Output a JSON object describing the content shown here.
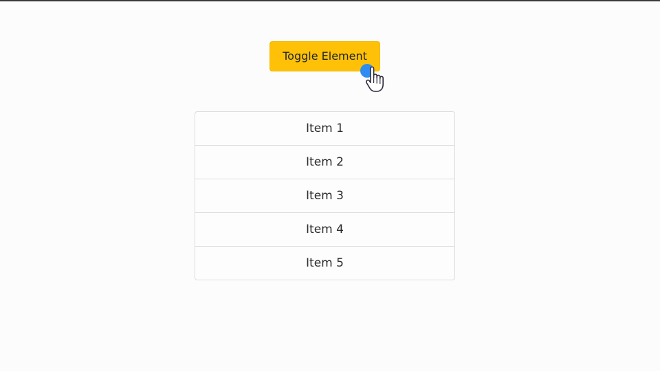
{
  "toggle_button": {
    "label": "Toggle Element",
    "color": "#ffc107"
  },
  "list": {
    "items": [
      {
        "label": "Item 1"
      },
      {
        "label": "Item 2"
      },
      {
        "label": "Item 3"
      },
      {
        "label": "Item 4"
      },
      {
        "label": "Item 5"
      }
    ]
  },
  "cursor": {
    "icon": "hand-pointer-icon",
    "click_indicator_color": "#2f8cf0"
  }
}
